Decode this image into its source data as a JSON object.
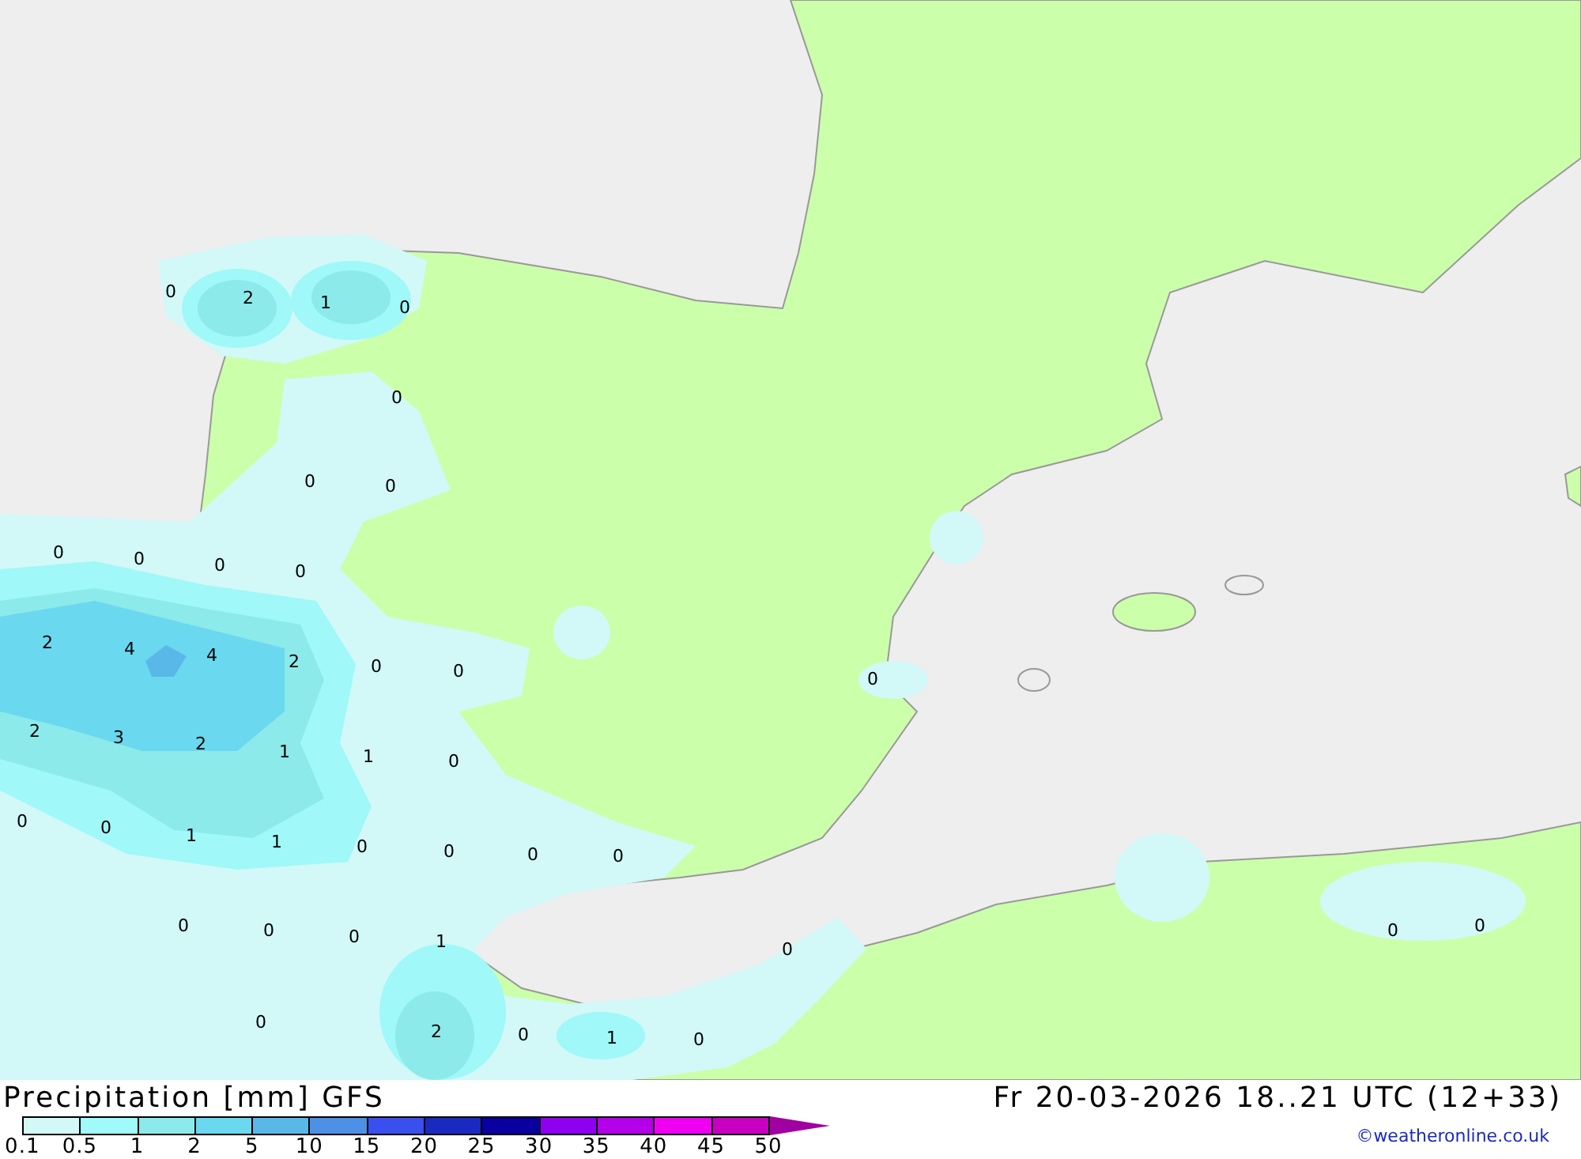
{
  "map": {
    "value_labels": [
      {
        "text": "0"
      },
      {
        "text": "2"
      },
      {
        "text": "1"
      },
      {
        "text": "0"
      },
      {
        "text": "0"
      },
      {
        "text": "0"
      },
      {
        "text": "0"
      },
      {
        "text": "0"
      },
      {
        "text": "0"
      },
      {
        "text": "0"
      },
      {
        "text": "0"
      },
      {
        "text": "2"
      },
      {
        "text": "4"
      },
      {
        "text": "4"
      },
      {
        "text": "2"
      },
      {
        "text": "0"
      },
      {
        "text": "0"
      },
      {
        "text": "0"
      },
      {
        "text": "2"
      },
      {
        "text": "3"
      },
      {
        "text": "2"
      },
      {
        "text": "1"
      },
      {
        "text": "1"
      },
      {
        "text": "0"
      },
      {
        "text": "0"
      },
      {
        "text": "0"
      },
      {
        "text": "1"
      },
      {
        "text": "1"
      },
      {
        "text": "0"
      },
      {
        "text": "0"
      },
      {
        "text": "0"
      },
      {
        "text": "0"
      },
      {
        "text": "0"
      },
      {
        "text": "0"
      },
      {
        "text": "0"
      },
      {
        "text": "1"
      },
      {
        "text": "0"
      },
      {
        "text": "0"
      },
      {
        "text": "0"
      },
      {
        "text": "0"
      },
      {
        "text": "2"
      },
      {
        "text": "0"
      },
      {
        "text": "1"
      },
      {
        "text": "0"
      }
    ]
  },
  "footer": {
    "title": "Precipitation [mm] GFS",
    "valid_time": "Fr 20-03-2026 18..21 UTC (12+33)",
    "credit": "©weatheronline.co.uk",
    "legend": {
      "segments": [
        {
          "color": "#d2f8f8"
        },
        {
          "color": "#a0fafa"
        },
        {
          "color": "#8ceaea"
        },
        {
          "color": "#6ad8ee"
        },
        {
          "color": "#5ab8e8"
        },
        {
          "color": "#4e90e6"
        },
        {
          "color": "#3a50ee"
        },
        {
          "color": "#1a2ac0"
        },
        {
          "color": "#0a00a0"
        },
        {
          "color": "#9000f0"
        },
        {
          "color": "#b400e8"
        },
        {
          "color": "#f000f0"
        },
        {
          "color": "#c800c0"
        },
        {
          "color": "#a000a0",
          "kind": "arrow"
        }
      ],
      "labels": [
        "0.1",
        "0.5",
        "1",
        "2",
        "5",
        "10",
        "15",
        "20",
        "25",
        "30",
        "35",
        "40",
        "45",
        "50"
      ]
    }
  }
}
